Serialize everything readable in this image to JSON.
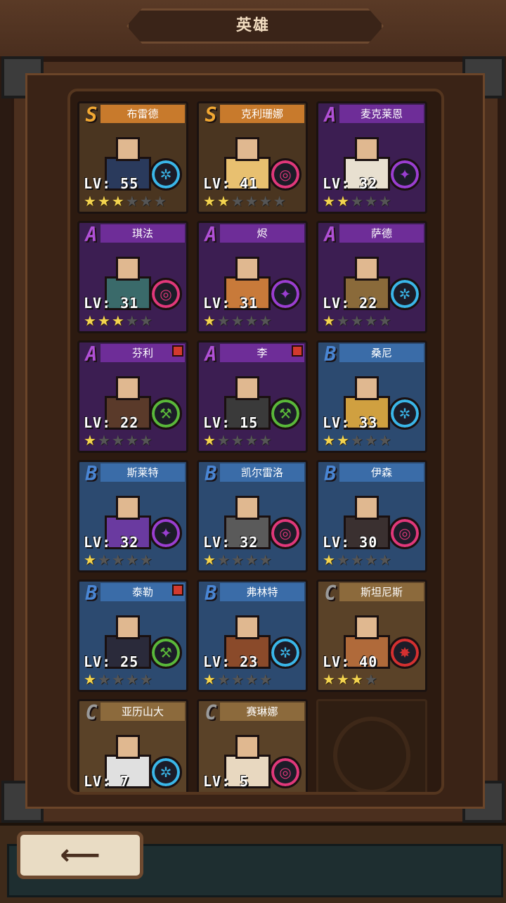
{
  "header": {
    "title": "英雄"
  },
  "heroes": [
    {
      "name": "布雷德",
      "rank": "S",
      "level": "LV: 55",
      "stars": 3,
      "skill": "ice",
      "notify": false
    },
    {
      "name": "克利珊娜",
      "rank": "S",
      "level": "LV: 41",
      "stars": 2,
      "skill": "target",
      "notify": false
    },
    {
      "name": "麦克莱恩",
      "rank": "A",
      "level": "LV: 32",
      "stars": 2,
      "skill": "magic",
      "notify": false
    },
    {
      "name": "琪法",
      "rank": "A",
      "level": "LV: 31",
      "stars": 3,
      "skill": "target",
      "notify": false
    },
    {
      "name": "烬",
      "rank": "A",
      "level": "LV: 31",
      "stars": 1,
      "skill": "magic",
      "notify": false
    },
    {
      "name": "萨德",
      "rank": "A",
      "level": "LV: 22",
      "stars": 1,
      "skill": "ice",
      "notify": false
    },
    {
      "name": "芬利",
      "rank": "A",
      "level": "LV: 22",
      "stars": 1,
      "skill": "pickaxe",
      "notify": true
    },
    {
      "name": "李",
      "rank": "A",
      "level": "LV: 15",
      "stars": 1,
      "skill": "pickaxe",
      "notify": true
    },
    {
      "name": "桑尼",
      "rank": "B",
      "level": "LV: 33",
      "stars": 2,
      "skill": "ice",
      "notify": false
    },
    {
      "name": "斯莱特",
      "rank": "B",
      "level": "LV: 32",
      "stars": 1,
      "skill": "magic",
      "notify": false
    },
    {
      "name": "凯尔雷洛",
      "rank": "B",
      "level": "LV: 32",
      "stars": 1,
      "skill": "target",
      "notify": false
    },
    {
      "name": "伊森",
      "rank": "B",
      "level": "LV: 30",
      "stars": 1,
      "skill": "target",
      "notify": false
    },
    {
      "name": "泰勒",
      "rank": "B",
      "level": "LV: 25",
      "stars": 1,
      "skill": "pickaxe",
      "notify": true
    },
    {
      "name": "弗林特",
      "rank": "B",
      "level": "LV: 23",
      "stars": 1,
      "skill": "ice",
      "notify": false
    },
    {
      "name": "斯坦尼斯",
      "rank": "C",
      "level": "LV: 40",
      "stars": 3,
      "skill": "fire",
      "notify": false
    },
    {
      "name": "亚历山大",
      "rank": "C",
      "level": "LV: 7",
      "stars": 0,
      "skill": "ice",
      "notify": false
    },
    {
      "name": "赛琳娜",
      "rank": "C",
      "level": "LV: 5",
      "stars": 0,
      "skill": "target",
      "notify": false
    }
  ],
  "max_stars": 6,
  "rank_max_stars": {
    "S": 6,
    "A": 5,
    "B": 5,
    "C": 4
  },
  "skill_icons": {
    "ice": {
      "symbol": "✲",
      "color": "#3ab6e8",
      "name": "ice-skill-icon"
    },
    "target": {
      "symbol": "◎",
      "color": "#e0387a",
      "name": "target-skill-icon"
    },
    "magic": {
      "symbol": "✦",
      "color": "#9a3ed0",
      "name": "magic-skill-icon"
    },
    "pickaxe": {
      "symbol": "⚒",
      "color": "#5ab83a",
      "name": "pickaxe-skill-icon"
    },
    "fire": {
      "symbol": "✸",
      "color": "#d43030",
      "name": "fire-skill-icon"
    }
  },
  "back_button": {
    "icon": "back-arrow-icon",
    "symbol": "⟵"
  }
}
